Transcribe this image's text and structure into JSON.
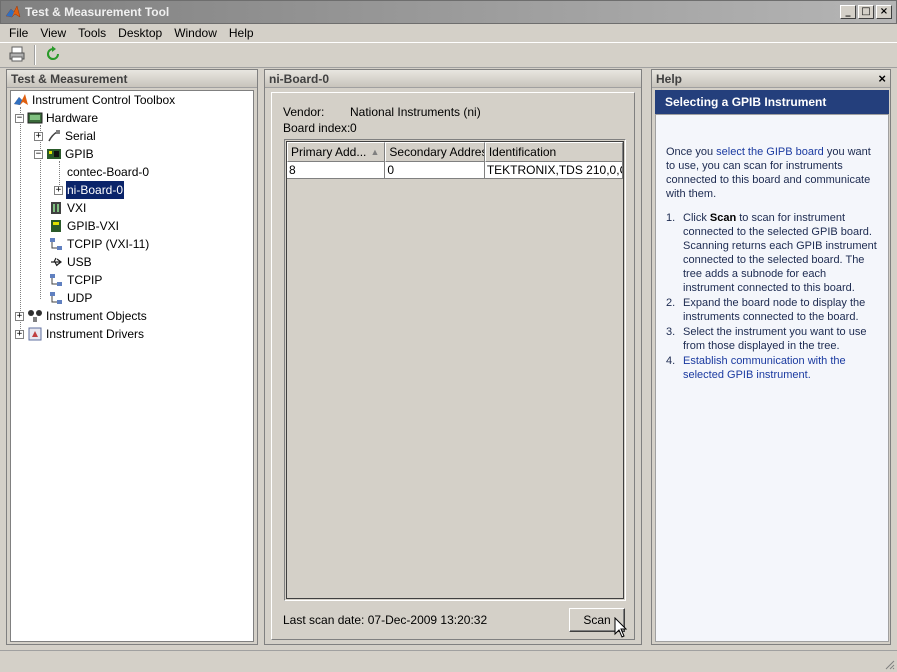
{
  "window": {
    "title": "Test & Measurement Tool",
    "controls": [
      "_",
      "□",
      "×"
    ]
  },
  "menu": [
    "File",
    "View",
    "Tools",
    "Desktop",
    "Window",
    "Help"
  ],
  "toolbar": {
    "icons": [
      "printer-icon",
      "refresh-icon"
    ]
  },
  "left_panel": {
    "title": "Test & Measurement",
    "tree": {
      "root": "Instrument Control Toolbox",
      "hardware": "Hardware",
      "serial": "Serial",
      "gpib": "GPIB",
      "contec": "contec-Board-0",
      "ni_board": "ni-Board-0",
      "vxi": "VXI",
      "gpib_vxi": "GPIB-VXI",
      "tcpip_vxi": "TCPIP (VXI-11)",
      "usb": "USB",
      "tcpip": "TCPIP",
      "udp": "UDP",
      "objects": "Instrument Objects",
      "drivers": "Instrument Drivers"
    }
  },
  "mid_panel": {
    "title": "ni-Board-0",
    "vendor_label": "Vendor:",
    "vendor_value": "National Instruments (ni)",
    "board_index_label": "Board index:",
    "board_index_value": "0",
    "table": {
      "headers": [
        "Primary Add...",
        "Secondary Address",
        "Identification"
      ],
      "rows": [
        [
          "8",
          "0",
          "TEKTRONIX,TDS 210,0,C..."
        ]
      ]
    },
    "last_scan": "Last scan date: 07-Dec-2009 13:20:32",
    "scan_label": "Scan"
  },
  "help_panel": {
    "title": "Help",
    "close": "×",
    "heading": "Selecting a GPIB Instrument",
    "intro_pre": "Once you ",
    "intro_link": "select the GIPB board",
    "intro_post": " you want to use, you can scan for instruments connected to this board and communicate with them.",
    "steps": [
      {
        "num": "1.",
        "pre": "Click ",
        "bold": "Scan",
        "post": " to scan for instrument connected to the selected GPIB board. Scanning returns each GPIB instrument connected to the selected board. The tree adds a subnode for each instrument connected to this board."
      },
      {
        "num": "2.",
        "pre": "Expand the board node to display the instruments connected to the board.",
        "bold": "",
        "post": ""
      },
      {
        "num": "3.",
        "pre": "Select the instrument you want to use from those displayed in the tree.",
        "bold": "",
        "post": ""
      },
      {
        "num": "4.",
        "pre": "",
        "link": "Establish communication with the selected GPIB instrument.",
        "bold": "",
        "post": ""
      }
    ]
  },
  "colors": {
    "selection": "#0a246a",
    "help_title_bg": "#243f7c",
    "link": "#1a3aa0"
  }
}
